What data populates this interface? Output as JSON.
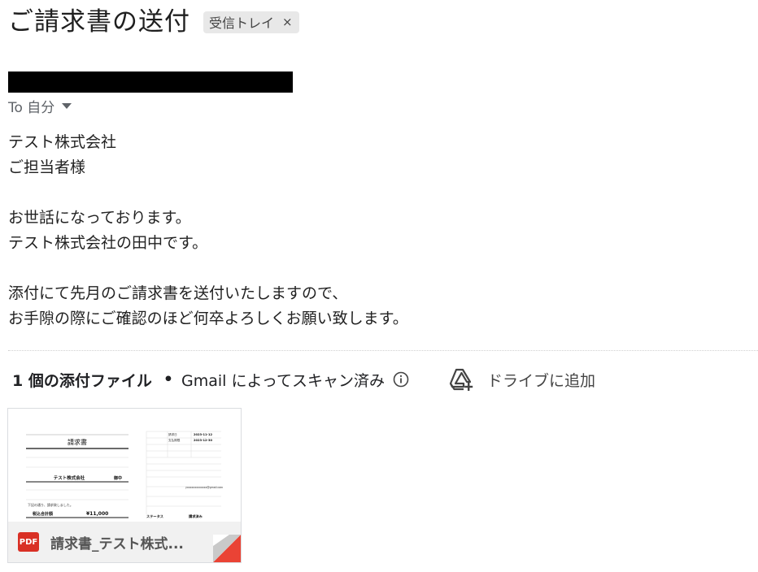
{
  "email": {
    "subject": "ご請求書の送付",
    "label": "受信トレイ",
    "label_remove": "×",
    "recipient": "To 自分",
    "body_lines": [
      "テスト株式会社",
      "ご担当者様",
      "",
      "お世話になっております。",
      "テスト株式会社の田中です。",
      "",
      "添付にて先月のご請求書を送付いたしますので、",
      "お手隙の際にご確認のほど何卒よろしくお願い致します。"
    ]
  },
  "attachments": {
    "count_label": "1 個の添付ファイル",
    "separator": "•",
    "scan_label": "Gmail によってスキャン済み",
    "info_icon": "info-icon",
    "drive_icon": "add-to-drive-icon",
    "drive_label": "ドライブに追加",
    "file": {
      "type_badge": "PDF",
      "name": "請求書_テスト株式...",
      "thumbnail": {
        "title": "請求書",
        "company": "テスト株式会社",
        "honorific": "御中",
        "note": "下記の通り、請求致しました。",
        "total_label": "税込合計額",
        "total_value": "¥11,000",
        "status_label": "ステータス",
        "status_value": "請求済み",
        "date1_label": "請求日",
        "date1": "2023-11-12",
        "date2_label": "支払期限",
        "date2": "2023-12-30",
        "email": "yxxxxxxxxxxxxx@gmail.com"
      }
    }
  },
  "colors": {
    "pdf_red": "#d93025",
    "fold_red": "#ea4335",
    "text": "#202124",
    "muted": "#5f6368"
  }
}
